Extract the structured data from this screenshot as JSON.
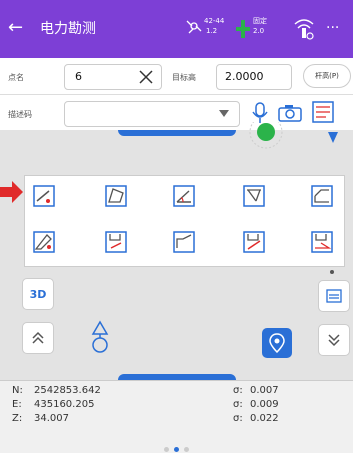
{
  "header": {
    "title": "电力勘测",
    "satellite_count": "42-44",
    "satellite_sub": "1.2",
    "solution_label": "固定",
    "solution_sub": "2.0",
    "more_label": "···"
  },
  "form": {
    "point_name_label": "点名",
    "point_name_value": "6",
    "target_height_label": "目标高",
    "target_height_value": "2.0000",
    "pole_height_button": "杆高(P)",
    "description_label": "描述码",
    "description_value": ""
  },
  "map_controls": {
    "view_3d_label": "3D"
  },
  "coords": {
    "n_label": "N:",
    "n_value": "2542853.642",
    "e_label": "E:",
    "e_value": "435160.205",
    "z_label": "Z:",
    "z_value": "34.007",
    "sigma_label": "σ:",
    "sigma_n": "0.007",
    "sigma_e": "0.009",
    "sigma_z": "0.022"
  },
  "colors": {
    "header": "#7d3fd6",
    "accent": "#2a6fd6",
    "alert": "#e02a2a",
    "gnss_fix": "#2bb34a"
  }
}
